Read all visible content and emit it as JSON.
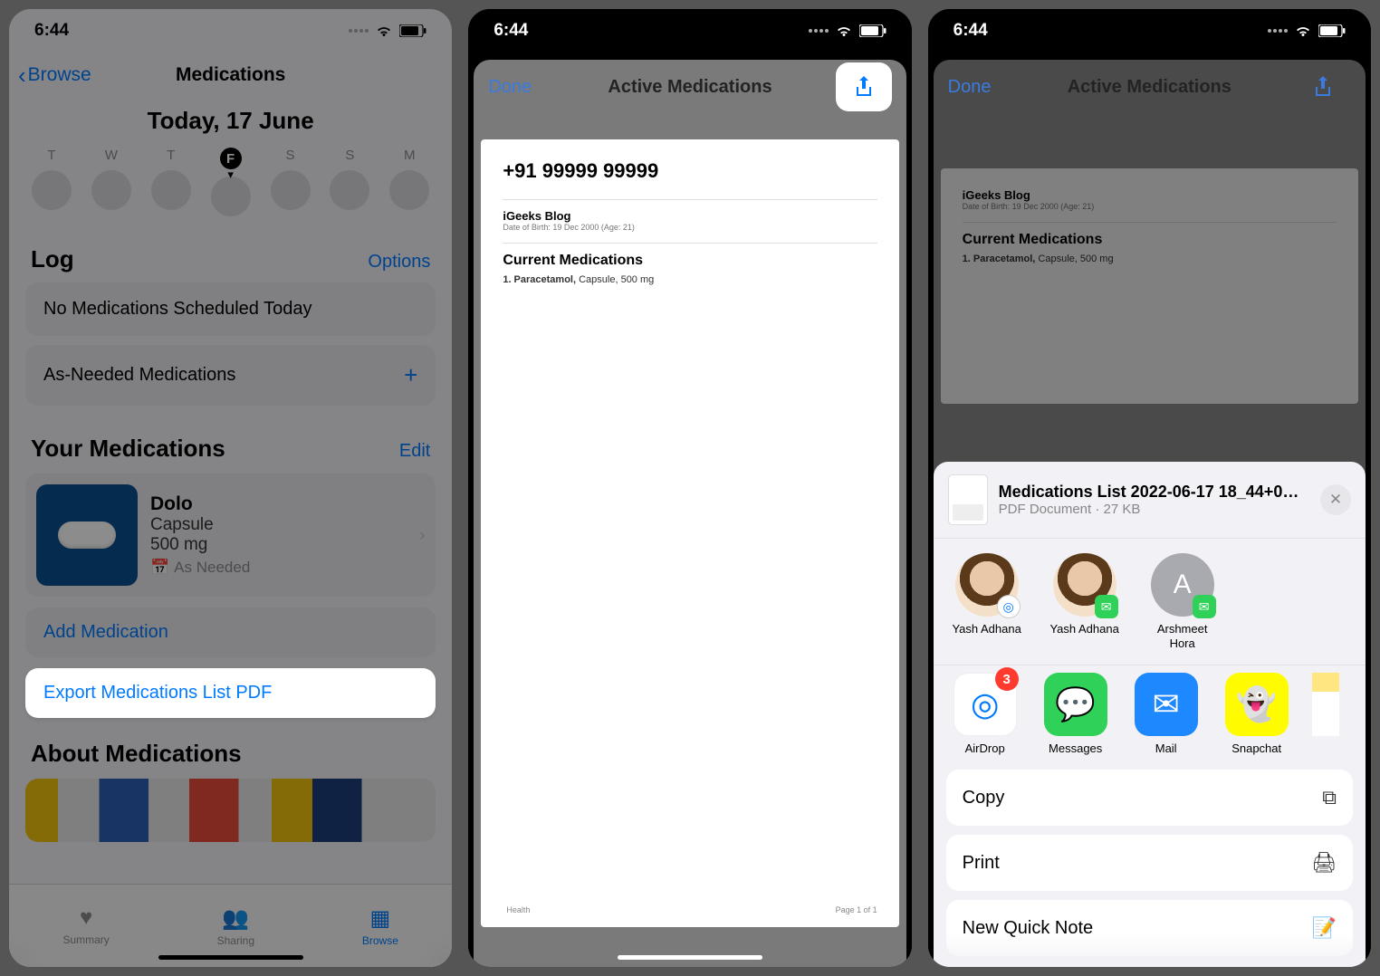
{
  "status": {
    "time": "6:44"
  },
  "screen1": {
    "back_label": "Browse",
    "title": "Medications",
    "date_header": "Today, 17 June",
    "days": [
      "T",
      "W",
      "T",
      "F",
      "S",
      "S",
      "M"
    ],
    "active_day_index": 3,
    "log": {
      "title": "Log",
      "options_label": "Options",
      "no_meds": "No Medications Scheduled Today",
      "as_needed": "As-Needed Medications"
    },
    "your_meds": {
      "title": "Your Medications",
      "edit_label": "Edit",
      "med": {
        "name": "Dolo",
        "form": "Capsule",
        "strength": "500 mg",
        "frequency": "As Needed"
      },
      "add_label": "Add Medication",
      "export_label": "Export Medications List PDF"
    },
    "about_title": "About Medications",
    "tabs": {
      "summary": "Summary",
      "sharing": "Sharing",
      "browse": "Browse"
    }
  },
  "screen2": {
    "done": "Done",
    "title": "Active Medications",
    "pdf": {
      "phone": "+91 99999 99999",
      "name": "iGeeks Blog",
      "dob": "Date of Birth: 19 Dec 2000 (Age: 21)",
      "section": "Current Medications",
      "med_line": "1. Paracetamol, Capsule, 500 mg",
      "footer_brand": "Health",
      "footer_page": "Page 1 of 1"
    }
  },
  "screen3": {
    "done": "Done",
    "title": "Active Medications",
    "pdf": {
      "name": "iGeeks Blog",
      "section": "Current Medications",
      "med_line": "1. Paracetamol, Capsule, 500 mg"
    },
    "share": {
      "file_name": "Medications List 2022-06-17 18_44+0…",
      "file_meta": "PDF Document · 27 KB",
      "contacts": [
        {
          "name": "Yash Adhana",
          "badge": "airdrop"
        },
        {
          "name": "Yash Adhana",
          "badge": "msg"
        },
        {
          "name": "Arshmeet Hora",
          "badge": "msg",
          "initial": "A"
        }
      ],
      "apps": [
        {
          "name": "AirDrop",
          "kind": "airdrop",
          "badge": "3"
        },
        {
          "name": "Messages",
          "kind": "messages"
        },
        {
          "name": "Mail",
          "kind": "mail"
        },
        {
          "name": "Snapchat",
          "kind": "snapchat"
        },
        {
          "name": "",
          "kind": "notes"
        }
      ],
      "actions": {
        "copy": "Copy",
        "print": "Print",
        "quicknote": "New Quick Note"
      }
    }
  }
}
